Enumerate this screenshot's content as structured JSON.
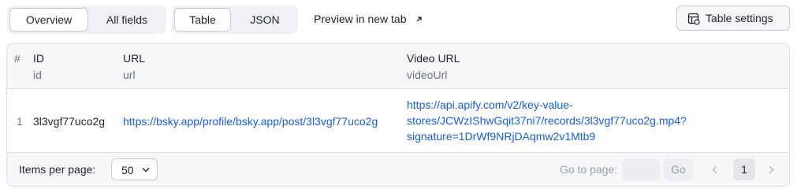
{
  "toolbar": {
    "view_tabs": [
      {
        "label": "Overview",
        "active": true
      },
      {
        "label": "All fields",
        "active": false
      }
    ],
    "format_tabs": [
      {
        "label": "Table",
        "active": true
      },
      {
        "label": "JSON",
        "active": false
      }
    ],
    "preview_label": "Preview in new tab",
    "preview_icon": "external-link-icon",
    "settings_label": "Table settings",
    "settings_icon": "table-settings-icon"
  },
  "table": {
    "columns": [
      {
        "name": "#",
        "key": ""
      },
      {
        "name": "ID",
        "key": "id"
      },
      {
        "name": "URL",
        "key": "url"
      },
      {
        "name": "Video URL",
        "key": "videoUrl"
      }
    ],
    "rows": [
      {
        "index": "1",
        "id": "3l3vgf77uco2g",
        "url": "https://bsky.app/profile/bsky.app/post/3l3vgf77uco2g",
        "video_url_lines": [
          "https://api.apify.com/v2/key-value-",
          "stores/JCWzIShwGqit37ni7/records/3l3vgf77uco2g.mp4?",
          "signature=1DrWf9NRjDAqmw2v1Mtb9"
        ]
      }
    ],
    "link_color": "#1a5fd6"
  },
  "footer": {
    "items_per_page_label": "Items per page:",
    "items_per_page_value": "50",
    "goto_label": "Go to page:",
    "go_label": "Go",
    "current_page": "1"
  }
}
